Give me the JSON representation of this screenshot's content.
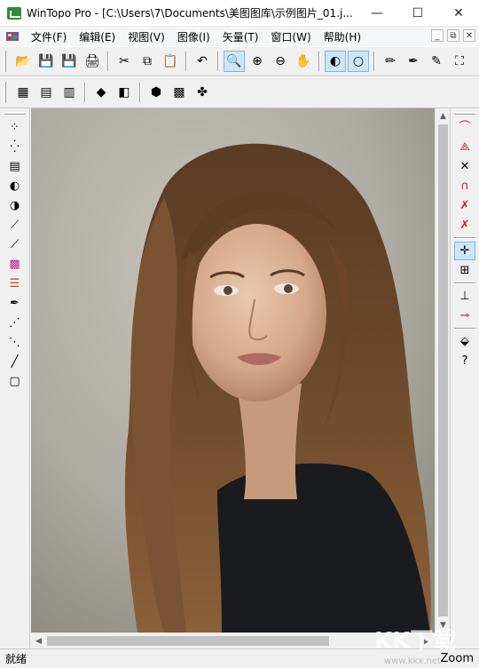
{
  "window": {
    "title": "WinTopo Pro - [C:\\Users\\7\\Documents\\美图图库\\示例图片_01.j...",
    "minimize": "—",
    "maximize": "☐",
    "close": "✕"
  },
  "menu": {
    "items": [
      "文件(F)",
      "编辑(E)",
      "视图(V)",
      "图像(I)",
      "矢量(T)",
      "窗口(W)",
      "帮助(H)"
    ],
    "mdi": [
      "_",
      "⧉",
      "✕"
    ]
  },
  "toolbar1": {
    "buttons": [
      {
        "icon": "open-folder-icon",
        "glyph": "📂"
      },
      {
        "icon": "save-icon",
        "glyph": "💾"
      },
      {
        "icon": "save-as-icon",
        "glyph": "💾"
      },
      {
        "icon": "print-icon",
        "glyph": "🖨"
      },
      {
        "icon": "cut-icon",
        "glyph": "✂"
      },
      {
        "icon": "copy-icon",
        "glyph": "⧉"
      },
      {
        "icon": "paste-icon",
        "glyph": "📋"
      },
      {
        "icon": "undo-icon",
        "glyph": "↶"
      },
      {
        "icon": "zoom-icon",
        "glyph": "🔍",
        "active": true
      },
      {
        "icon": "zoom-in-icon",
        "glyph": "⊕"
      },
      {
        "icon": "zoom-out-icon",
        "glyph": "⊖"
      },
      {
        "icon": "pan-hand-icon",
        "glyph": "✋"
      },
      {
        "icon": "raster-view-icon",
        "glyph": "◐",
        "active": true
      },
      {
        "icon": "vector-view-icon",
        "glyph": "○",
        "active": true
      },
      {
        "icon": "pencil-icon",
        "glyph": "✏"
      },
      {
        "icon": "pen-icon",
        "glyph": "✒"
      },
      {
        "icon": "edit-vector-icon",
        "glyph": "✎"
      },
      {
        "icon": "crop-icon",
        "glyph": "⛶"
      }
    ]
  },
  "toolbar2": {
    "buttons": [
      {
        "icon": "thin-icon",
        "glyph": "▦"
      },
      {
        "icon": "threshold-icon",
        "glyph": "▤"
      },
      {
        "icon": "colour-reduce-icon",
        "glyph": "▥"
      },
      {
        "icon": "layers-icon",
        "glyph": "◆"
      },
      {
        "icon": "overlay-icon",
        "glyph": "◧"
      },
      {
        "icon": "shield-icon",
        "glyph": "⬢"
      },
      {
        "icon": "vectorize-icon",
        "glyph": "▩"
      },
      {
        "icon": "wizard-icon",
        "glyph": "✤"
      }
    ]
  },
  "left_tools": [
    {
      "icon": "dots-icon",
      "glyph": "⁘"
    },
    {
      "icon": "speckle-icon",
      "glyph": "⁛"
    },
    {
      "icon": "grayscale-icon",
      "glyph": "▤"
    },
    {
      "icon": "half-circle-icon",
      "glyph": "◐"
    },
    {
      "icon": "contrast-icon",
      "glyph": "◑"
    },
    {
      "icon": "line-tool-icon",
      "glyph": "⟋"
    },
    {
      "icon": "measure-icon",
      "glyph": "⟋"
    },
    {
      "icon": "colour-icon",
      "glyph": "▩"
    },
    {
      "icon": "palette-icon",
      "glyph": "☰"
    },
    {
      "icon": "draw-icon",
      "glyph": "✒"
    },
    {
      "icon": "dashed-line-icon",
      "glyph": "⋰"
    },
    {
      "icon": "dotted-line-icon",
      "glyph": "⋱"
    },
    {
      "icon": "solid-line-icon",
      "glyph": "╱"
    },
    {
      "icon": "rectangle-icon",
      "glyph": "▢"
    }
  ],
  "right_tools": [
    {
      "icon": "node-curve-icon",
      "glyph": "⌒"
    },
    {
      "icon": "node-polyline-icon",
      "glyph": "⟁"
    },
    {
      "icon": "node-cross-icon",
      "glyph": "✕"
    },
    {
      "icon": "node-arc-icon",
      "glyph": "∩"
    },
    {
      "icon": "node-delete-icon",
      "glyph": "✗"
    },
    {
      "icon": "node-remove-icon",
      "glyph": "✗"
    },
    {
      "icon": "snap-icon",
      "glyph": "✛",
      "active": true
    },
    {
      "icon": "snap-grid-icon",
      "glyph": "⊞"
    },
    {
      "icon": "split-icon",
      "glyph": "⊥"
    },
    {
      "icon": "join-icon",
      "glyph": "⊸"
    },
    {
      "icon": "fill-icon",
      "glyph": "⬙"
    },
    {
      "icon": "help-cursor-icon",
      "glyph": "?"
    }
  ],
  "scroll": {
    "up": "▲",
    "down": "▼",
    "left": "◀",
    "right": "▶"
  },
  "status": {
    "left": "就绪",
    "right": "Zoom"
  },
  "watermark": {
    "url": "www.kkx.net"
  }
}
